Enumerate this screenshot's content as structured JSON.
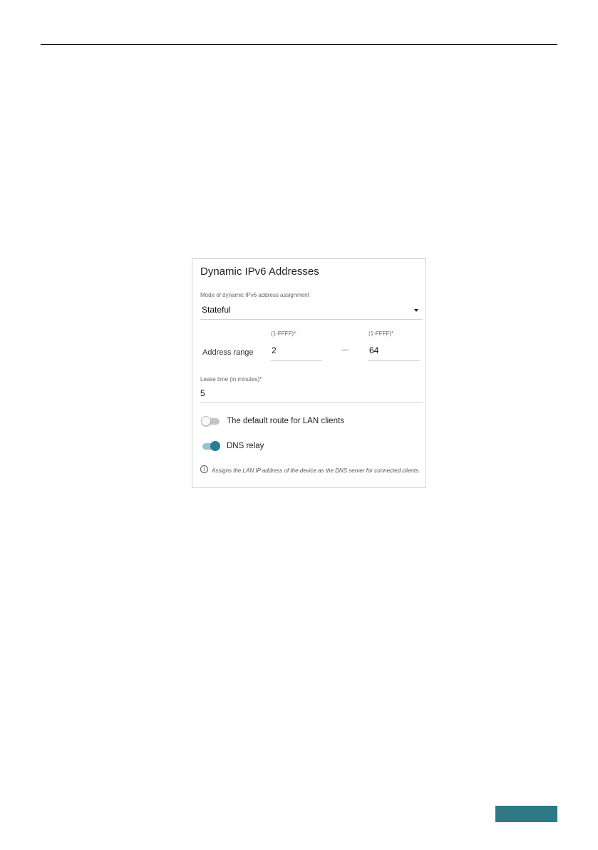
{
  "panel": {
    "title": "Dynamic IPv6 Addresses",
    "mode": {
      "label": "Mode of dynamic IPv6 address assignment",
      "value": "Stateful",
      "dropdown_icon": "caret-down-icon"
    },
    "address_range": {
      "label": "Address range",
      "start": {
        "hint": "(1-FFFF)",
        "required_mark": "*",
        "value": "2"
      },
      "separator": "—",
      "end": {
        "hint": "(1-FFFF)",
        "required_mark": "*",
        "value": "64"
      }
    },
    "lease_time": {
      "label": "Lease time (in minutes)",
      "required_mark": "*",
      "value": "5"
    },
    "default_route": {
      "label": "The default route for LAN clients",
      "enabled": false
    },
    "dns_relay": {
      "label": "DNS relay",
      "enabled": true
    },
    "info": {
      "icon": "info-icon",
      "text": "Assigns the LAN IP address of the device as the DNS server for connected clients."
    }
  },
  "colors": {
    "accent": "#2a7d93",
    "required": "#e0442c",
    "footer_bar": "#2f7886"
  }
}
